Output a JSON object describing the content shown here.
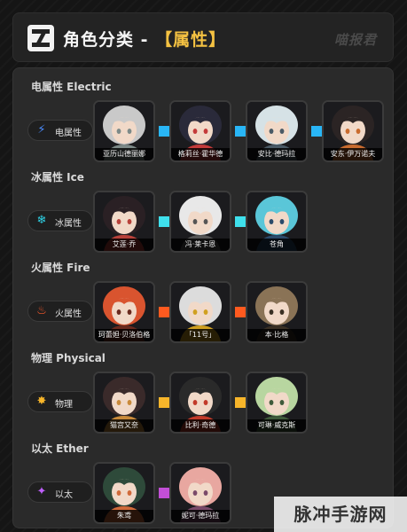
{
  "header": {
    "title_main": "角色分类 - ",
    "title_accent": "【属性】",
    "watermark": "喵报君"
  },
  "sections": [
    {
      "key": "electric",
      "title": "电属性  Electric",
      "pill_label": "电属性",
      "icon": "electric-bolt-icon",
      "icon_color": "#4a8cff",
      "connector_color": "#29b6f6",
      "characters": [
        "亚历山德丽娜",
        "格莉丝·霍华德",
        "安比·德玛拉",
        "安东·伊万诺夫"
      ]
    },
    {
      "key": "ice",
      "title": "冰属性  Ice",
      "pill_label": "冰属性",
      "icon": "snowflake-icon",
      "icon_color": "#2fd4e8",
      "connector_color": "#3fe0ec",
      "characters": [
        "艾莲·乔",
        "冯·莱卡恩",
        "苍角"
      ]
    },
    {
      "key": "fire",
      "title": "火属性  Fire",
      "pill_label": "火属性",
      "icon": "flame-icon",
      "icon_color": "#ff5a2b",
      "connector_color": "#ff5a1f",
      "characters": [
        "珂蕾妲·贝洛伯格",
        "「11号」",
        "本·比格"
      ]
    },
    {
      "key": "physical",
      "title": "物理  Physical",
      "pill_label": "物理",
      "icon": "gear-burst-icon",
      "icon_color": "#f7b52a",
      "connector_color": "#f7b52a",
      "characters": [
        "猫宫又奈",
        "比利·奇德",
        "可琳·威克斯"
      ]
    },
    {
      "key": "ether",
      "title": "以太  Ether",
      "pill_label": "以太",
      "icon": "ether-sparkle-icon",
      "icon_color": "#c060ff",
      "connector_color": "#c24fd6",
      "characters": [
        "朱鸢",
        "妮可·德玛拉"
      ]
    }
  ],
  "footer": {
    "watermark": "脉冲手游网"
  }
}
